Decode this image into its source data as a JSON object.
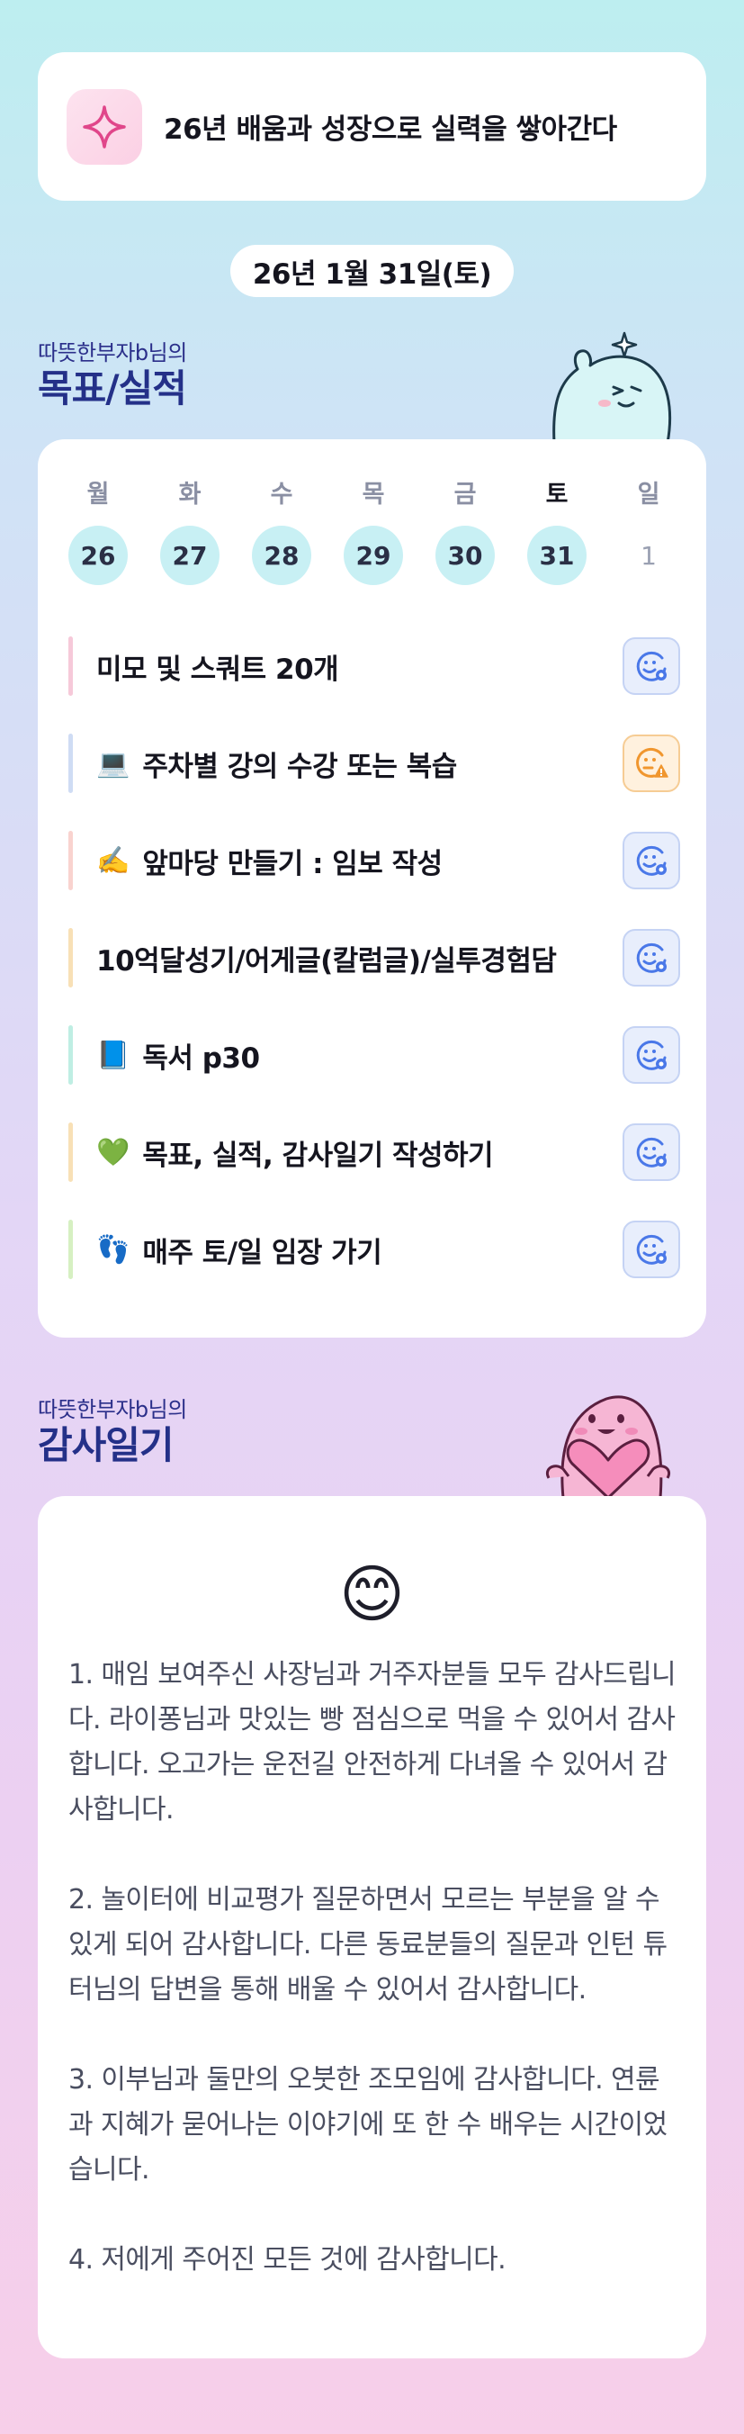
{
  "header": {
    "icon": "sparkle-icon",
    "title": "26년 배움과 성장으로 실력을 쌓아간다"
  },
  "date": "26년 1월 31일(토)",
  "goals_section": {
    "subtitle": "따뜻한부자b님의",
    "title": "목표/실적"
  },
  "week": [
    {
      "name": "월",
      "num": "26",
      "filled": true,
      "today": false
    },
    {
      "name": "화",
      "num": "27",
      "filled": true,
      "today": false
    },
    {
      "name": "수",
      "num": "28",
      "filled": true,
      "today": false
    },
    {
      "name": "목",
      "num": "29",
      "filled": true,
      "today": false
    },
    {
      "name": "금",
      "num": "30",
      "filled": true,
      "today": false
    },
    {
      "name": "토",
      "num": "31",
      "filled": true,
      "today": true
    },
    {
      "name": "일",
      "num": "1",
      "filled": false,
      "today": false
    }
  ],
  "tasks": [
    {
      "emoji": "",
      "label": "미모 및 스쿼트 20개",
      "bar_color": "#f6c9d9",
      "status": "done"
    },
    {
      "emoji": "💻",
      "label": "주차별 강의 수강 또는 복습",
      "bar_color": "#cfdcf4",
      "status": "warn"
    },
    {
      "emoji": "✍️",
      "label": "앞마당 만들기 : 임보 작성",
      "bar_color": "#f9d3cf",
      "status": "done"
    },
    {
      "emoji": "",
      "label": "10억달성기/어게글(칼럼글)/실투경험담",
      "bar_color": "#f8e0b6",
      "status": "done"
    },
    {
      "emoji": "📘",
      "label": "독서 p30",
      "bar_color": "#bfeee3",
      "status": "done"
    },
    {
      "emoji": "💚",
      "label": "목표, 실적, 감사일기 작성하기",
      "bar_color": "#f8e0b6",
      "status": "done"
    },
    {
      "emoji": "👣",
      "label": "매주 토/일 임장 가기",
      "bar_color": "#d6f0c2",
      "status": "done"
    }
  ],
  "gratitude_section": {
    "subtitle": "따뜻한부자b님의",
    "title": "감사일기",
    "emoji": "😊",
    "entries": [
      "1. 매임 보여주신 사장님과 거주자분들 모두 감사드립니다. 라이퐁님과 맛있는 빵 점심으로 먹을 수 있어서 감사합니다. 오고가는 운전길 안전하게 다녀올 수 있어서 감사합니다.",
      "2. 놀이터에 비교평가 질문하면서 모르는 부분을 알 수 있게 되어 감사합니다. 다른 동료분들의 질문과 인턴 튜터님의 답변을 통해 배울 수 있어서 감사합니다.",
      "3. 이부님과 둘만의 오붓한 조모임에 감사합니다. 연륜과 지혜가 묻어나는 이야기에 또 한 수 배우는 시간이었습니다.",
      "4. 저에게 주어진 모든 것에 감사합니다."
    ]
  },
  "colors": {
    "accent_navy": "#243088",
    "day_fill": "#c8f0f4",
    "status_done": "#4a78e8",
    "status_warn": "#f0962e"
  }
}
